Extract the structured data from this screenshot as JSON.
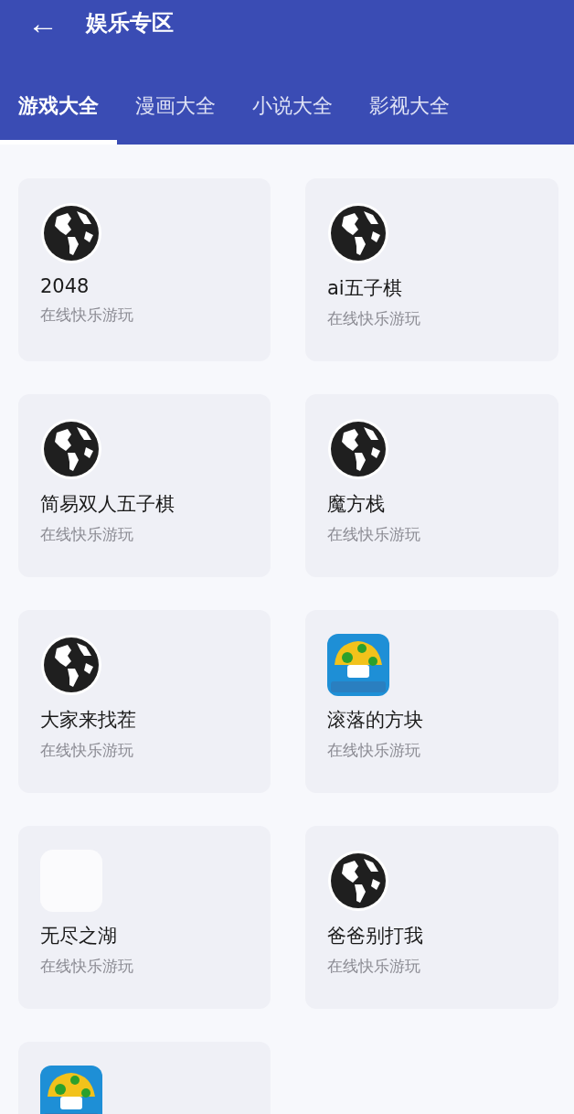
{
  "header": {
    "back": "←",
    "title": "娱乐专区"
  },
  "tabs": [
    {
      "label": "游戏大全",
      "selected": true
    },
    {
      "label": "漫画大全",
      "selected": false
    },
    {
      "label": "小说大全",
      "selected": false
    },
    {
      "label": "影视大全",
      "selected": false
    }
  ],
  "games": [
    {
      "kind": "globe",
      "name": "2048",
      "subtitle": "在线快乐游玩"
    },
    {
      "kind": "globe",
      "name": "ai五子棋",
      "subtitle": "在线快乐游玩"
    },
    {
      "kind": "globe",
      "name": "简易双人五子棋",
      "subtitle": "在线快乐游玩"
    },
    {
      "kind": "globe",
      "name": "魔方栈",
      "subtitle": "在线快乐游玩"
    },
    {
      "kind": "globe",
      "name": "大家来找茬",
      "subtitle": "在线快乐游玩"
    },
    {
      "kind": "mushroom",
      "name": "滚落的方块",
      "subtitle": "在线快乐游玩"
    },
    {
      "kind": "blank",
      "name": "无尽之湖",
      "subtitle": "在线快乐游玩"
    },
    {
      "kind": "globe",
      "name": "爸爸别打我",
      "subtitle": "在线快乐游玩"
    },
    {
      "kind": "mushroom"
    }
  ]
}
